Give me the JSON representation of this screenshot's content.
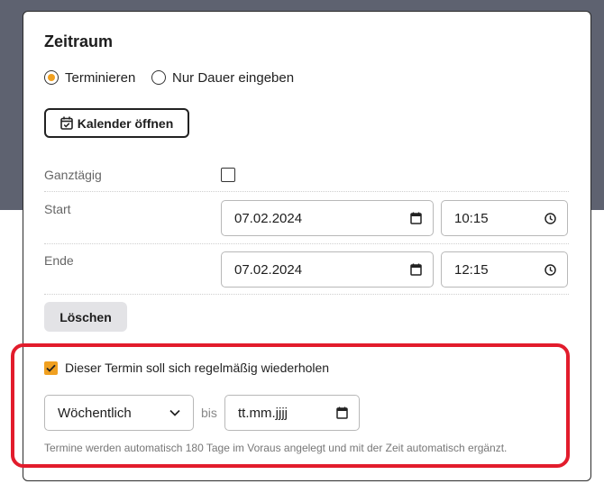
{
  "section": {
    "title": "Zeitraum"
  },
  "mode": {
    "options": [
      {
        "label": "Terminieren",
        "selected": true
      },
      {
        "label": "Nur Dauer eingeben",
        "selected": false
      }
    ]
  },
  "calendar_button": {
    "label": "Kalender öffnen",
    "icon": "calendar-check-icon"
  },
  "allday": {
    "label": "Ganztägig",
    "checked": false
  },
  "start": {
    "label": "Start",
    "date": "07.02.2024",
    "time": "10:15"
  },
  "end": {
    "label": "Ende",
    "date": "07.02.2024",
    "time": "12:15"
  },
  "delete_button": {
    "label": "Löschen"
  },
  "recurrence": {
    "checkbox_label": "Dieser Termin soll sich regelmäßig wiederholen",
    "checked": true,
    "frequency": "Wöchentlich",
    "until_label": "bis",
    "until_placeholder": "tt.mm.jjjj",
    "hint": "Termine werden automatisch 180 Tage im Voraus angelegt und mit der Zeit automatisch ergänzt."
  },
  "colors": {
    "accent": "#f0a020",
    "highlight": "#e21c2c",
    "backdrop": "#5e6270"
  }
}
